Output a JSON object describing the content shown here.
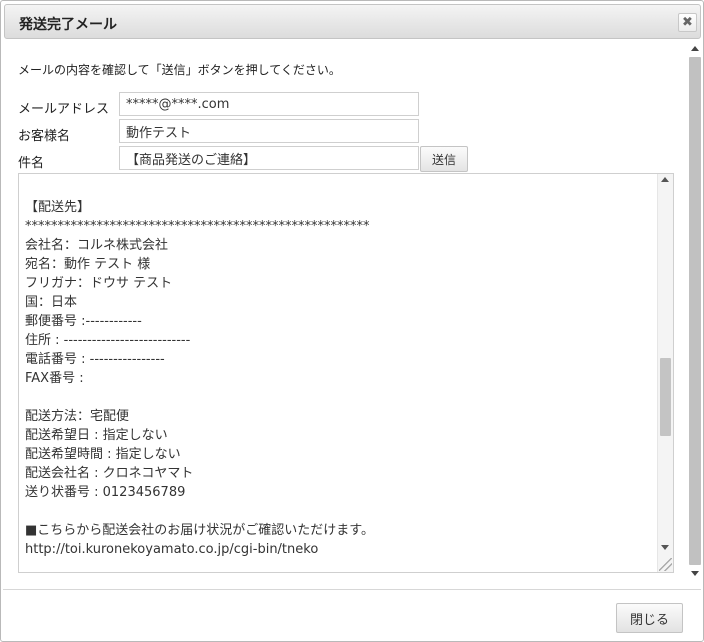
{
  "dialog": {
    "title": "発送完了メール",
    "close_glyph": "✖"
  },
  "instruction": "メールの内容を確認して「送信」ボタンを押してください。",
  "form": {
    "email_label": "メールアドレス",
    "email_value": "*****@****.com",
    "customer_label": "お客様名",
    "customer_value": "動作テスト",
    "subject_label": "件名",
    "subject_value": "【商品発送のご連絡】",
    "send_label": "送信"
  },
  "body_text": "\n\n【配送先】\n*****************************************************\n会社名：コルネ株式会社\n宛名：動作 テスト 様\nフリガナ：ドウサ テスト\n国：日本\n郵便番号 :------------\n住所 : ---------------------------\n電話番号 : ----------------\nFAX番号 :\n\n配送方法：宅配便\n配送希望日 : 指定しない\n配送希望時間 : 指定しない\n配送会社名 : クロネコヤマト\n送り状番号 : 0123456789\n\n■こちらから配送会社のお届け状況がご確認いただけます。\nhttp://toi.kuronekoyamato.co.jp/cgi-bin/tneko",
  "footer": {
    "close_label": "閉じる"
  }
}
